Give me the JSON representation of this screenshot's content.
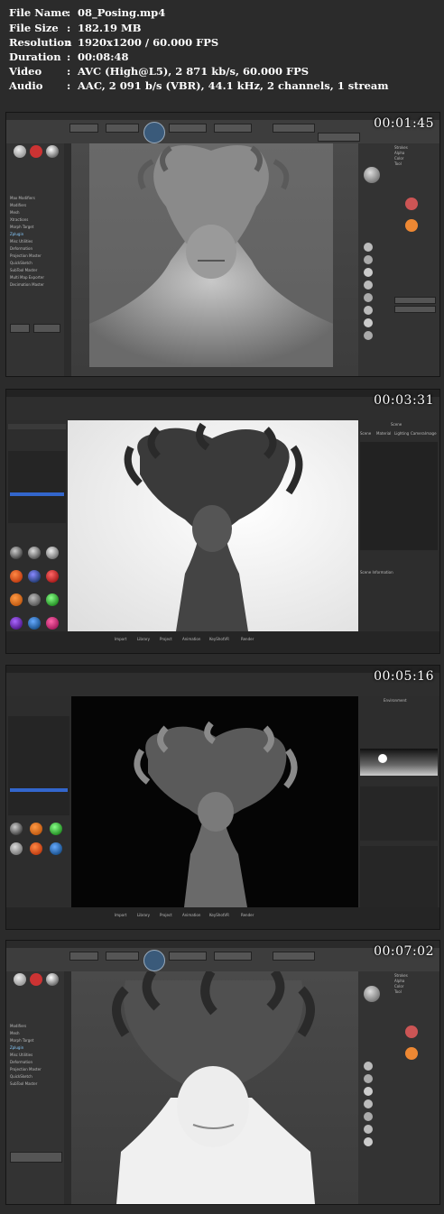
{
  "file_info": {
    "rows": [
      {
        "key": "File Name",
        "value": "08_Posing.mp4"
      },
      {
        "key": "File Size",
        "value": "182.19 MB"
      },
      {
        "key": "Resolution",
        "value": "1920x1200 / 60.000 FPS"
      },
      {
        "key": "Duration",
        "value": "00:08:48"
      },
      {
        "key": "Video",
        "value": "AVC (High@L5), 2 871 kb/s, 60.000 FPS"
      },
      {
        "key": "Audio",
        "value": "AAC, 2 091 b/s (VBR), 44.1 kHz, 2 channels, 1 stream"
      }
    ],
    "colon": ":"
  },
  "frames": [
    {
      "timestamp": "00:01:45"
    },
    {
      "timestamp": "00:03:31"
    },
    {
      "timestamp": "00:05:16"
    },
    {
      "timestamp": "00:07:02"
    }
  ],
  "zbrush": {
    "sidebar_labels": [
      "Max Modifiers",
      "Modifiers",
      "Mesh",
      "Xtractions",
      "Morph Target",
      "Zplugin",
      "Misc Utilities",
      "Deformation",
      "Projection Master",
      "QuickSketch",
      "SubTool Master",
      "Multi Map Exporter",
      "Decimation Master"
    ],
    "palette_labels": [
      "Strokes",
      "Alpha",
      "Color",
      "Tool"
    ]
  },
  "keyshot": {
    "right_title": "Scene",
    "right_tabs": [
      "Scene",
      "Material",
      "Lighting",
      "Camera",
      "Image"
    ],
    "scene_info": "Scene Information",
    "bottom_tabs": [
      "Import",
      "Library",
      "Project",
      "Animation",
      "KeyShotVR",
      "Render"
    ],
    "env_title": "Environment"
  }
}
